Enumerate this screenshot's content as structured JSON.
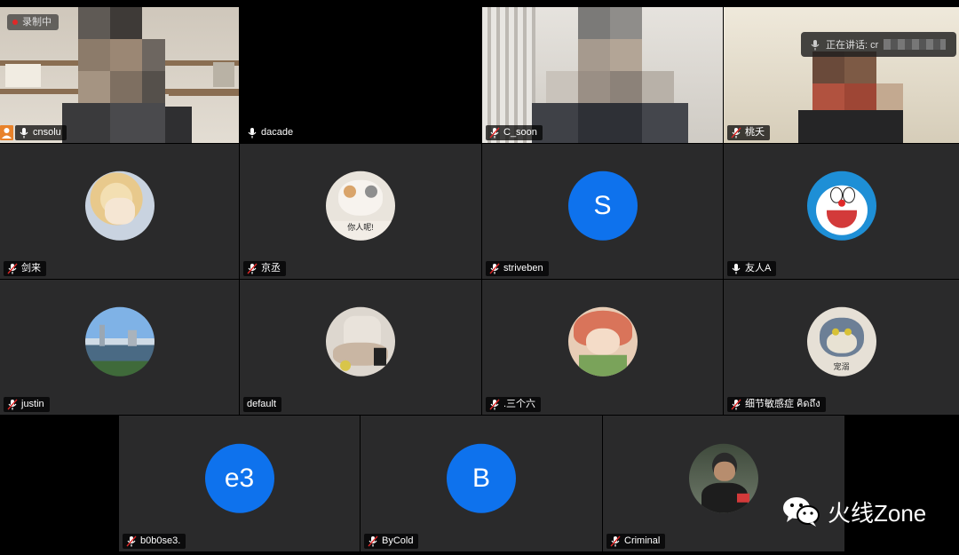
{
  "recording": {
    "label": "录制中"
  },
  "speaking": {
    "prefix": "正在讲话: cr"
  },
  "watermark": {
    "text": "火线Zone",
    "icon": "wechat-icon"
  },
  "participants": [
    {
      "name": "cnsolu",
      "type": "video",
      "muted": false
    },
    {
      "name": "dacade",
      "type": "empty",
      "muted": false
    },
    {
      "name": "C_soon",
      "type": "video",
      "muted": true
    },
    {
      "name": "桃夭",
      "type": "video",
      "muted": true
    },
    {
      "name": "剑来",
      "type": "avatar",
      "muted": true
    },
    {
      "name": "京丞",
      "type": "avatar",
      "muted": true,
      "avatar_caption": "你人呢!"
    },
    {
      "name": "striveben",
      "type": "letter",
      "letter": "S",
      "muted": true
    },
    {
      "name": "友人A",
      "type": "avatar",
      "muted": false
    },
    {
      "name": "justin",
      "type": "avatar",
      "muted": true
    },
    {
      "name": "default",
      "type": "avatar",
      "muted": null
    },
    {
      "name": ".三个六",
      "type": "avatar",
      "muted": true
    },
    {
      "name": "细节敏感症 คิดถึง",
      "type": "avatar",
      "muted": true,
      "avatar_caption": "宠溺"
    },
    {
      "name": "b0b0se3.",
      "type": "letter",
      "letter": "e3",
      "muted": true
    },
    {
      "name": "ByCold",
      "type": "letter",
      "letter": "B",
      "muted": true
    },
    {
      "name": "Criminal",
      "type": "avatar",
      "muted": true
    }
  ],
  "colors": {
    "zoom_blue": "#0e72ed",
    "active_speaker": "#2ecc71",
    "tile_bg": "#2a2a2b"
  }
}
